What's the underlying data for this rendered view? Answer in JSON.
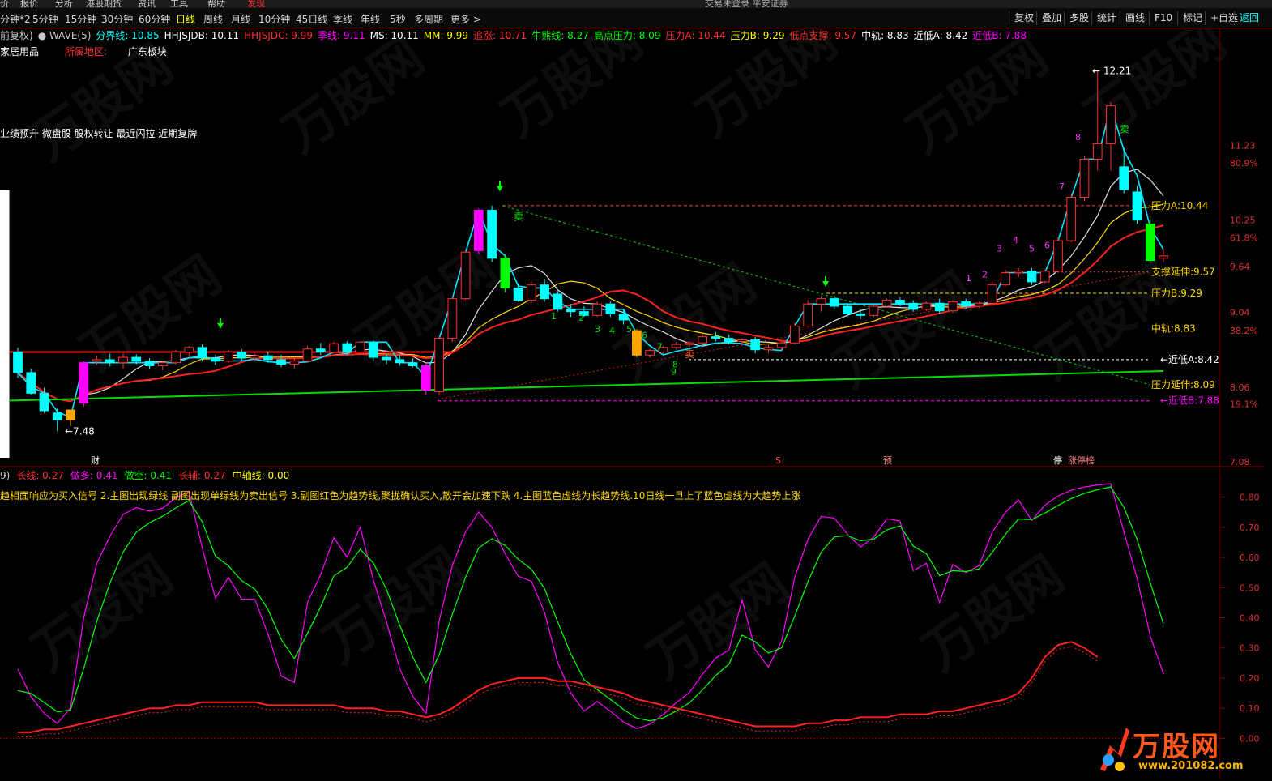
{
  "menubar": {
    "items": [
      "价",
      "报价",
      "分析",
      "港股期货",
      "资讯",
      "工具",
      "帮助",
      "发现"
    ],
    "title": "交易未登录  平安证券"
  },
  "periods": [
    "分钟*2",
    "5分钟",
    "15分钟",
    "30分钟",
    "60分钟",
    "日线",
    "周线",
    "月线",
    "10分钟",
    "45日线",
    "季线",
    "年线",
    "5秒",
    "多周期",
    "更多 >"
  ],
  "active_period": "日线",
  "right_buttons": [
    "复权",
    "叠加",
    "多股",
    "统计",
    "画线",
    "F10",
    "标记",
    "+自选",
    "返回"
  ],
  "info": [
    {
      "t": "前复权)",
      "c": "#c8c8c8"
    },
    {
      "t": "● WAVE(5)",
      "c": "#c8c8c8"
    },
    {
      "t": "分界线: 10.85",
      "c": "#00ffff"
    },
    {
      "t": "HHJSJDB: 10.11",
      "c": "#ffffff"
    },
    {
      "t": "HHJSJDC: 9.99",
      "c": "#ff3030"
    },
    {
      "t": "季线: 9.11",
      "c": "#ff00ff"
    },
    {
      "t": "MS: 10.11",
      "c": "#ffffff"
    },
    {
      "t": "MM: 9.99",
      "c": "#ffff00"
    },
    {
      "t": "追涨: 10.71",
      "c": "#ff3030"
    },
    {
      "t": "牛熊线: 8.27",
      "c": "#00ff00"
    },
    {
      "t": "高点压力: 8.09",
      "c": "#00ff00"
    },
    {
      "t": "压力A: 10.44",
      "c": "#ff3030"
    },
    {
      "t": "压力B: 9.29",
      "c": "#ffff00"
    },
    {
      "t": "低点支撑: 9.57",
      "c": "#ff3030"
    },
    {
      "t": "中轨: 8.83",
      "c": "#ffffff"
    },
    {
      "t": "近低A: 8.42",
      "c": "#ffffff"
    },
    {
      "t": "近低B: 7.88",
      "c": "#ff00ff"
    }
  ],
  "industry": "家居用品",
  "region_label": "所属地区:",
  "region_value": "广东板块",
  "tags": "业绩预升 微盘股 股权转让 最近闪拉 近期复牌",
  "sub_info": [
    {
      "t": "9)",
      "c": "#c8c8c8"
    },
    {
      "t": "长线: 0.27",
      "c": "#ff3030"
    },
    {
      "t": "做多: 0.41",
      "c": "#ff00ff"
    },
    {
      "t": "做空: 0.41",
      "c": "#00ff00"
    },
    {
      "t": "长辅: 0.27",
      "c": "#ff3030"
    },
    {
      "t": "中轴线: 0.00",
      "c": "#ffff00"
    }
  ],
  "sub_text": "趋相面响应为买入信号 2.主图出现绿线 副图出现单绿线为卖出信号 3.副图红色为趋势线,聚拢确认买入,散开会加速下跌 4.主图蓝色虚线为长趋势线.10日线一旦上了蓝色虚线为大趋势上涨",
  "right_axis_main": [
    "11.23",
    "80.9%",
    "10.25",
    "61.8%",
    "9.64",
    "9.04",
    "38.2%",
    "8.06",
    "19.1%",
    "7.08"
  ],
  "right_axis_sub": [
    "0.80",
    "0.70",
    "0.60",
    "0.50",
    "0.40",
    "0.30",
    "0.20",
    "0.10",
    "0.00"
  ],
  "level_labels": [
    "压力A:10.44",
    "支撑延伸:9.57",
    "压力B:9.29",
    "中轨:8.83",
    "近低A:8.42",
    "压力延伸:8.09",
    "近低B:7.88"
  ],
  "annotations": {
    "high": "12.21",
    "low": "7.48",
    "sell": "卖",
    "bottom_marks": [
      "财",
      "S",
      "预",
      "停",
      "涨停榜"
    ]
  },
  "count_marks": [
    "1",
    "2",
    "3",
    "4",
    "5",
    "6",
    "7",
    "8",
    "9"
  ],
  "logo": {
    "text": "万股网",
    "site": "www.201082.com"
  },
  "watermark": "万股网",
  "colors": {
    "up": "#ff3030",
    "down": "#00ffff",
    "magenta": "#ff00ff",
    "green": "#00ff00",
    "orange": "#ffa500",
    "yellow": "#ffff00"
  },
  "chart_data": {
    "type": "candlestick",
    "candles": [
      {
        "o": 8.52,
        "h": 8.58,
        "l": 8.18,
        "c": 8.25
      },
      {
        "o": 8.25,
        "h": 8.3,
        "l": 7.95,
        "c": 7.98
      },
      {
        "o": 7.98,
        "h": 8.05,
        "l": 7.72,
        "c": 7.75
      },
      {
        "o": 7.72,
        "h": 7.78,
        "l": 7.48,
        "c": 7.63
      },
      {
        "o": 7.63,
        "h": 7.76,
        "l": 7.55,
        "c": 7.76
      },
      {
        "o": 7.85,
        "h": 8.4,
        "l": 7.8,
        "c": 8.38
      },
      {
        "o": 8.4,
        "h": 8.47,
        "l": 8.35,
        "c": 8.42
      },
      {
        "o": 8.42,
        "h": 8.5,
        "l": 8.33,
        "c": 8.38
      },
      {
        "o": 8.38,
        "h": 8.5,
        "l": 8.3,
        "c": 8.45
      },
      {
        "o": 8.45,
        "h": 8.49,
        "l": 8.36,
        "c": 8.4
      },
      {
        "o": 8.4,
        "h": 8.44,
        "l": 8.3,
        "c": 8.34
      },
      {
        "o": 8.34,
        "h": 8.4,
        "l": 8.28,
        "c": 8.38
      },
      {
        "o": 8.38,
        "h": 8.55,
        "l": 8.36,
        "c": 8.52
      },
      {
        "o": 8.52,
        "h": 8.6,
        "l": 8.45,
        "c": 8.58
      },
      {
        "o": 8.58,
        "h": 8.62,
        "l": 8.4,
        "c": 8.44
      },
      {
        "o": 8.44,
        "h": 8.48,
        "l": 8.35,
        "c": 8.4
      },
      {
        "o": 8.4,
        "h": 8.55,
        "l": 8.38,
        "c": 8.52
      },
      {
        "o": 8.52,
        "h": 8.56,
        "l": 8.4,
        "c": 8.44
      },
      {
        "o": 8.44,
        "h": 8.5,
        "l": 8.4,
        "c": 8.47
      },
      {
        "o": 8.47,
        "h": 8.52,
        "l": 8.38,
        "c": 8.42
      },
      {
        "o": 8.42,
        "h": 8.48,
        "l": 8.32,
        "c": 8.36
      },
      {
        "o": 8.36,
        "h": 8.44,
        "l": 8.3,
        "c": 8.4
      },
      {
        "o": 8.4,
        "h": 8.6,
        "l": 8.38,
        "c": 8.56
      },
      {
        "o": 8.56,
        "h": 8.64,
        "l": 8.48,
        "c": 8.52
      },
      {
        "o": 8.52,
        "h": 8.66,
        "l": 8.5,
        "c": 8.63
      },
      {
        "o": 8.63,
        "h": 8.66,
        "l": 8.48,
        "c": 8.52
      },
      {
        "o": 8.52,
        "h": 8.66,
        "l": 8.5,
        "c": 8.65
      },
      {
        "o": 8.65,
        "h": 8.67,
        "l": 8.4,
        "c": 8.45
      },
      {
        "o": 8.45,
        "h": 8.5,
        "l": 8.36,
        "c": 8.42
      },
      {
        "o": 8.42,
        "h": 8.48,
        "l": 8.34,
        "c": 8.38
      },
      {
        "o": 8.38,
        "h": 8.44,
        "l": 8.32,
        "c": 8.34
      },
      {
        "o": 8.34,
        "h": 8.38,
        "l": 7.95,
        "c": 8.02
      },
      {
        "o": 8.0,
        "h": 8.72,
        "l": 7.95,
        "c": 8.7
      },
      {
        "o": 8.7,
        "h": 9.25,
        "l": 8.65,
        "c": 9.22
      },
      {
        "o": 9.22,
        "h": 9.85,
        "l": 9.2,
        "c": 9.83
      },
      {
        "o": 9.85,
        "h": 10.4,
        "l": 9.8,
        "c": 10.38
      },
      {
        "o": 10.38,
        "h": 10.44,
        "l": 9.7,
        "c": 9.75
      },
      {
        "o": 9.75,
        "h": 9.8,
        "l": 9.3,
        "c": 9.36
      },
      {
        "o": 9.36,
        "h": 9.42,
        "l": 9.18,
        "c": 9.2
      },
      {
        "o": 9.2,
        "h": 9.45,
        "l": 9.16,
        "c": 9.4
      },
      {
        "o": 9.4,
        "h": 9.48,
        "l": 9.18,
        "c": 9.22
      },
      {
        "o": 9.28,
        "h": 9.32,
        "l": 9.05,
        "c": 9.08
      },
      {
        "o": 9.08,
        "h": 9.15,
        "l": 8.98,
        "c": 9.05
      },
      {
        "o": 9.05,
        "h": 9.12,
        "l": 8.98,
        "c": 9.0
      },
      {
        "o": 9.0,
        "h": 9.18,
        "l": 8.98,
        "c": 9.15
      },
      {
        "o": 9.15,
        "h": 9.18,
        "l": 8.98,
        "c": 9.02
      },
      {
        "o": 9.02,
        "h": 9.08,
        "l": 8.88,
        "c": 8.94
      },
      {
        "o": 8.8,
        "h": 8.82,
        "l": 8.45,
        "c": 8.48
      },
      {
        "o": 8.48,
        "h": 8.56,
        "l": 8.44,
        "c": 8.54
      },
      {
        "o": 8.52,
        "h": 8.6,
        "l": 8.5,
        "c": 8.58
      },
      {
        "o": 8.58,
        "h": 8.65,
        "l": 8.55,
        "c": 8.62
      },
      {
        "o": 8.62,
        "h": 8.66,
        "l": 8.58,
        "c": 8.64
      },
      {
        "o": 8.64,
        "h": 8.76,
        "l": 8.6,
        "c": 8.72
      },
      {
        "o": 8.72,
        "h": 8.78,
        "l": 8.66,
        "c": 8.7
      },
      {
        "o": 8.7,
        "h": 8.75,
        "l": 8.62,
        "c": 8.66
      },
      {
        "o": 8.66,
        "h": 8.7,
        "l": 8.6,
        "c": 8.68
      },
      {
        "o": 8.68,
        "h": 8.72,
        "l": 8.5,
        "c": 8.55
      },
      {
        "o": 8.55,
        "h": 8.62,
        "l": 8.5,
        "c": 8.58
      },
      {
        "o": 8.58,
        "h": 8.66,
        "l": 8.55,
        "c": 8.64
      },
      {
        "o": 8.64,
        "h": 8.9,
        "l": 8.62,
        "c": 8.86
      },
      {
        "o": 8.86,
        "h": 9.2,
        "l": 8.84,
        "c": 9.15
      },
      {
        "o": 9.15,
        "h": 9.25,
        "l": 9.05,
        "c": 9.22
      },
      {
        "o": 9.22,
        "h": 9.26,
        "l": 9.08,
        "c": 9.12
      },
      {
        "o": 9.12,
        "h": 9.16,
        "l": 8.98,
        "c": 9.02
      },
      {
        "o": 9.02,
        "h": 9.08,
        "l": 8.95,
        "c": 9.0
      },
      {
        "o": 9.0,
        "h": 9.14,
        "l": 8.98,
        "c": 9.12
      },
      {
        "o": 9.12,
        "h": 9.22,
        "l": 9.1,
        "c": 9.2
      },
      {
        "o": 9.2,
        "h": 9.24,
        "l": 9.12,
        "c": 9.16
      },
      {
        "o": 9.16,
        "h": 9.2,
        "l": 9.05,
        "c": 9.08
      },
      {
        "o": 9.08,
        "h": 9.18,
        "l": 9.06,
        "c": 9.16
      },
      {
        "o": 9.16,
        "h": 9.22,
        "l": 9.02,
        "c": 9.06
      },
      {
        "o": 9.06,
        "h": 9.2,
        "l": 9.04,
        "c": 9.18
      },
      {
        "o": 9.18,
        "h": 9.22,
        "l": 9.08,
        "c": 9.12
      },
      {
        "o": 9.12,
        "h": 9.18,
        "l": 9.1,
        "c": 9.16
      },
      {
        "o": 9.16,
        "h": 9.45,
        "l": 9.14,
        "c": 9.4
      },
      {
        "o": 9.4,
        "h": 9.6,
        "l": 9.38,
        "c": 9.56
      },
      {
        "o": 9.56,
        "h": 9.62,
        "l": 9.5,
        "c": 9.58
      },
      {
        "o": 9.58,
        "h": 9.62,
        "l": 9.4,
        "c": 9.44
      },
      {
        "o": 9.44,
        "h": 9.6,
        "l": 9.42,
        "c": 9.58
      },
      {
        "o": 9.58,
        "h": 10.02,
        "l": 9.56,
        "c": 9.98
      },
      {
        "o": 9.98,
        "h": 10.6,
        "l": 9.96,
        "c": 10.55
      },
      {
        "o": 10.55,
        "h": 11.1,
        "l": 10.5,
        "c": 11.05
      },
      {
        "o": 11.05,
        "h": 12.21,
        "l": 10.9,
        "c": 11.25
      },
      {
        "o": 11.25,
        "h": 11.8,
        "l": 10.9,
        "c": 11.75
      },
      {
        "o": 10.95,
        "h": 11.2,
        "l": 10.6,
        "c": 10.65
      },
      {
        "o": 10.62,
        "h": 10.7,
        "l": 10.2,
        "c": 10.25
      },
      {
        "o": 10.2,
        "h": 10.26,
        "l": 9.68,
        "c": 9.72
      },
      {
        "o": 9.75,
        "h": 9.88,
        "l": 9.7,
        "c": 9.78
      }
    ],
    "ylim": [
      7.08,
      12.5
    ],
    "levels": {
      "pressureA": 10.44,
      "supportExt": 9.57,
      "pressureB": 9.29,
      "midRail": 8.83,
      "lowA": 8.42,
      "pressureExt": 8.09,
      "lowB": 7.88
    },
    "oscillator": {
      "ylim": [
        -0.05,
        0.85
      ],
      "long_line": [
        0.02,
        0.02,
        0.03,
        0.03,
        0.04,
        0.05,
        0.06,
        0.07,
        0.08,
        0.09,
        0.1,
        0.1,
        0.11,
        0.11,
        0.12,
        0.12,
        0.12,
        0.12,
        0.12,
        0.11,
        0.11,
        0.11,
        0.11,
        0.11,
        0.11,
        0.1,
        0.1,
        0.1,
        0.09,
        0.09,
        0.08,
        0.07,
        0.08,
        0.1,
        0.13,
        0.16,
        0.18,
        0.19,
        0.2,
        0.2,
        0.2,
        0.19,
        0.19,
        0.18,
        0.17,
        0.16,
        0.15,
        0.13,
        0.12,
        0.11,
        0.1,
        0.09,
        0.08,
        0.07,
        0.06,
        0.05,
        0.04,
        0.04,
        0.04,
        0.04,
        0.05,
        0.05,
        0.06,
        0.06,
        0.07,
        0.07,
        0.07,
        0.08,
        0.08,
        0.08,
        0.09,
        0.09,
        0.1,
        0.11,
        0.12,
        0.13,
        0.15,
        0.2,
        0.27,
        0.31,
        0.32,
        0.3,
        0.27
      ]
    }
  }
}
